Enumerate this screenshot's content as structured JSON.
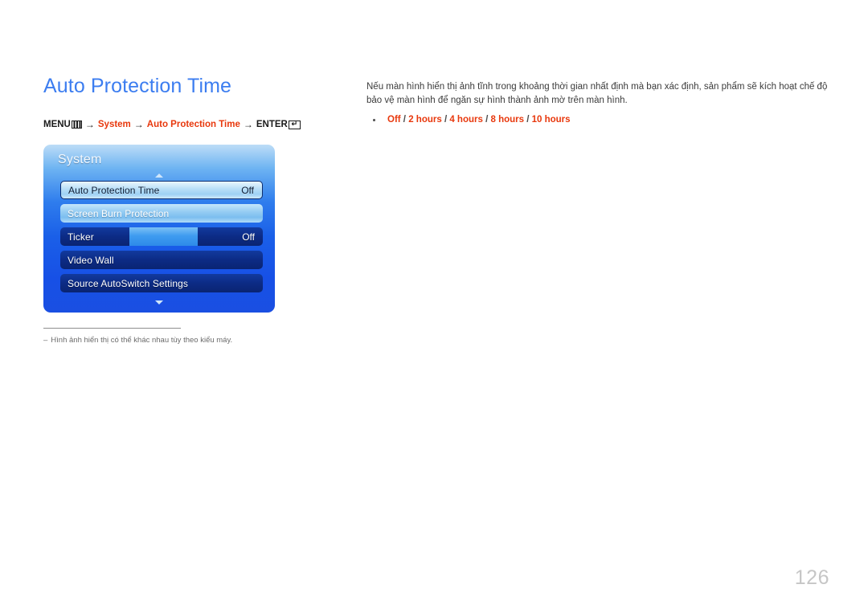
{
  "page": {
    "title": "Auto Protection Time",
    "number": "126",
    "title_color": "#3c7df0",
    "accent_color": "#e8380d"
  },
  "breadcrumb": {
    "menu_label": "MENU",
    "menu_icon": "menu-bars-icon",
    "arrow": "→",
    "step_system": "System",
    "step_feature": "Auto Protection Time",
    "enter_label": "ENTER",
    "enter_icon": "enter-return-icon",
    "enter_glyph": "↵"
  },
  "osd": {
    "title": "System",
    "scroll_up_icon": "triangle-up-icon",
    "scroll_down_icon": "triangle-down-icon",
    "rows": [
      {
        "label": "Auto Protection Time",
        "value": "Off",
        "style": "sel"
      },
      {
        "label": "Screen Burn Protection",
        "value": "",
        "style": "light"
      },
      {
        "label": "Ticker",
        "value": "Off",
        "style": "dark",
        "block": true
      },
      {
        "label": "Video Wall",
        "value": "",
        "style": "dark"
      },
      {
        "label": "Source AutoSwitch Settings",
        "value": "",
        "style": "dark"
      }
    ]
  },
  "footnote": {
    "dash": "–",
    "text": "Hình ảnh hiển thị có thể khác nhau tùy theo kiểu máy."
  },
  "content": {
    "description": "Nếu màn hình hiển thị ảnh tĩnh trong khoảng thời gian nhất định mà bạn xác định, sản phẩm sẽ kích hoạt chế độ bảo vệ màn hình để ngăn sự hình thành ảnh mờ trên màn hình.",
    "options": [
      "Off",
      "2 hours",
      "4 hours",
      "8 hours",
      "10 hours"
    ],
    "option_separator": "/"
  }
}
